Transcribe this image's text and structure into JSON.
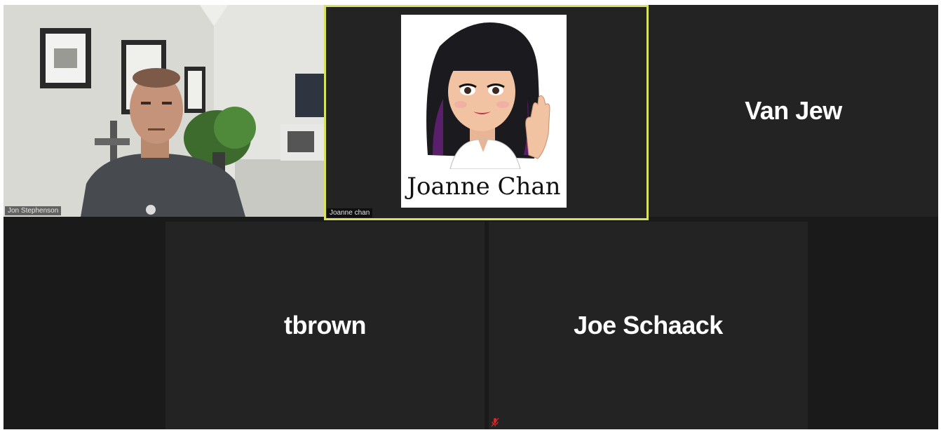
{
  "meeting": {
    "participants": [
      {
        "id": "jon",
        "tag_label": "Jon Stephenson",
        "mode": "video"
      },
      {
        "id": "joanne",
        "tag_label": "Joanne chan",
        "mode": "avatar",
        "avatar_caption": "Joanne Chan",
        "active_speaker": true
      },
      {
        "id": "van",
        "display_name": "Van Jew",
        "mode": "name-only"
      },
      {
        "id": "tbrown",
        "display_name": "tbrown",
        "mode": "name-only"
      },
      {
        "id": "joe",
        "display_name": "Joe Schaack",
        "mode": "name-only",
        "muted": true
      }
    ]
  },
  "colors": {
    "active_speaker_border": "#d8e25a",
    "tile_background": "#232323",
    "muted_icon": "#d9262b"
  },
  "icons": {
    "muted": "mic-muted-icon"
  }
}
